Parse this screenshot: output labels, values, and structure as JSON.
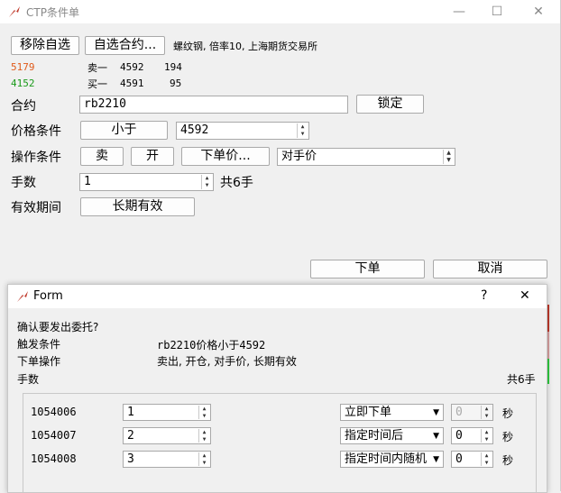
{
  "app": {
    "title": "CTP条件单",
    "minimize_label": "—",
    "maximize_label": "☐",
    "close_label": "✕"
  },
  "toolbar": {
    "remove_button": "移除自选",
    "add_button": "自选合约...",
    "contract_info": "螺纹钢, 倍率10, 上海期货交易所"
  },
  "quotes": {
    "ask": {
      "volume": "5179",
      "label": "卖一",
      "price": "4592",
      "size": "194",
      "color": "#e05a1a"
    },
    "bid": {
      "volume": "4152",
      "label": "买一",
      "price": "4591",
      "size": "95",
      "color": "#1a9a1a"
    }
  },
  "form": {
    "contract_label": "合约",
    "contract_value": "rb2210",
    "lock_button": "锁定",
    "price_cond_label": "价格条件",
    "price_cond_op": "小于",
    "price_value": "4592",
    "op_cond_label": "操作条件",
    "op_direction": "卖",
    "op_offset": "开",
    "order_price_button": "下单价...",
    "price_type_value": "对手价",
    "qty_label": "手数",
    "qty_value": "1",
    "qty_total": "共6手",
    "validity_label": "有效期间",
    "validity_value": "长期有效",
    "submit_button": "下单",
    "cancel_button": "取消"
  },
  "dialog": {
    "title": "Form",
    "help_label": "?",
    "close_label": "✕",
    "question": "确认要发出委托?",
    "trigger_label": "触发条件",
    "trigger_value": "rb2210价格小于4592",
    "action_label": "下单操作",
    "action_value": "卖出, 开仓, 对手价, 长期有效",
    "qty_label": "手数",
    "qty_total": "共6手",
    "rows": [
      {
        "id": "1054006",
        "qty": "1",
        "mode": "立即下单",
        "seconds": "0",
        "unit": "秒",
        "seconds_disabled": true
      },
      {
        "id": "1054007",
        "qty": "2",
        "mode": "指定时间后",
        "seconds": "0",
        "unit": "秒",
        "seconds_disabled": false
      },
      {
        "id": "1054008",
        "qty": "3",
        "mode": "指定时间内随机",
        "seconds": "0",
        "unit": "秒",
        "seconds_disabled": false
      }
    ]
  }
}
